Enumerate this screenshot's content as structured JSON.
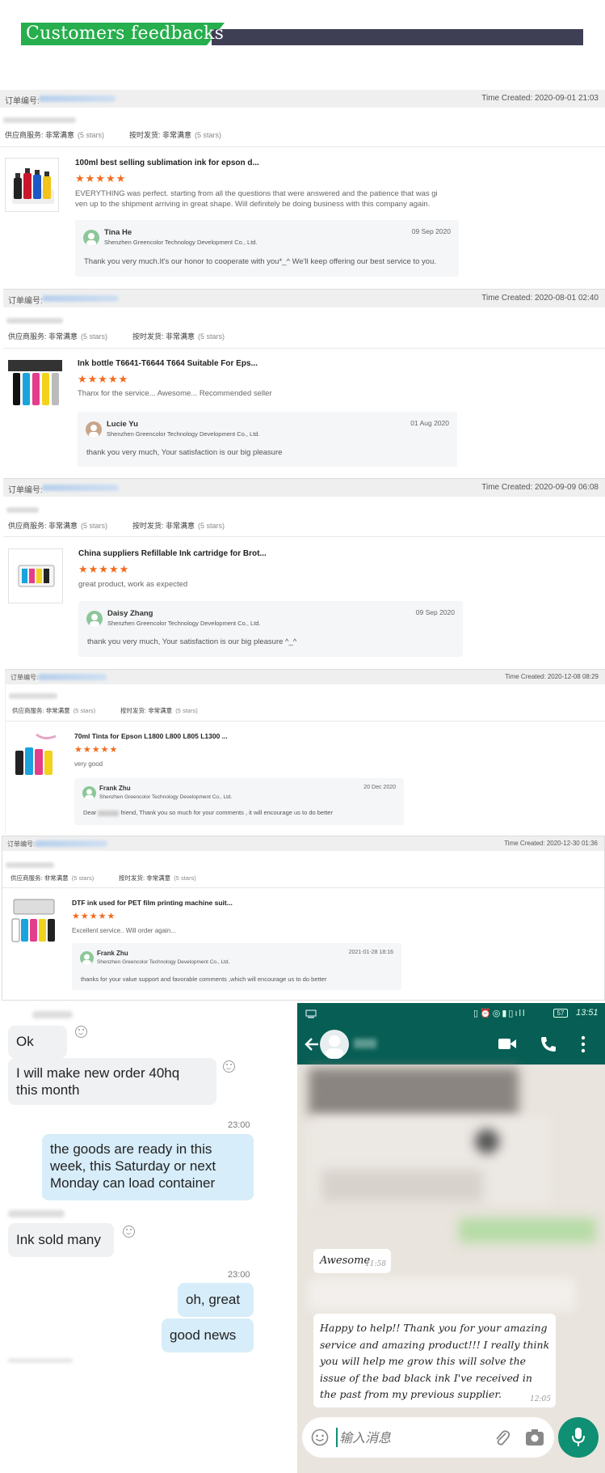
{
  "header": {
    "title": "Customers feedbacks",
    "accent": "#27ae4d",
    "bar_color": "#3e3f55"
  },
  "labels": {
    "order_no": "订单编号:",
    "time_prefix": "Time Created: ",
    "supplier_service": "供应商服务:",
    "ship_on_time": "按时发货:",
    "very_satisfied": "非常满意",
    "five_stars": "(5 stars)",
    "stars": "★★★★★",
    "company": "Shenzhen Greencolor Technology Development Co., Ltd."
  },
  "reviews": [
    {
      "time": "2020-09-01 21:03",
      "product": "100ml best selling sublimation ink for epson d...",
      "text_lines": [
        "EVERYTHING was perfect. starting from all the questions that were answered and the patience that was gi",
        "ven up to the shipment arriving in great shape. Will definitely be doing business with this company again."
      ],
      "reply_name": "Tina He",
      "reply_date": "09 Sep 2020",
      "reply_text": "Thank you very much.It's our honor to cooperate with you*_^  We'll keep offering our best service to you."
    },
    {
      "time": "2020-08-01 02:40",
      "product": "Ink bottle T6641-T6644 T664 Suitable For Eps...",
      "text_lines": [
        "Thanx for the service... Awesome... Recommended seller"
      ],
      "reply_name": "Lucie Yu",
      "reply_date": "01 Aug 2020",
      "reply_text": "thank you very much, Your satisfaction is our big pleasure"
    },
    {
      "time": "2020-09-09 06:08",
      "product": "China suppliers Refillable Ink cartridge for Brot...",
      "text_lines": [
        "great product, work as expected"
      ],
      "reply_name": "Daisy Zhang",
      "reply_date": "09 Sep 2020",
      "reply_text": "thank you very much, Your satisfaction is our big pleasure ^_^"
    },
    {
      "time": "2020-12-08 08:29",
      "product": "70ml Tinta for Epson L1800 L800 L805 L1300 ...",
      "text_lines": [
        "very good"
      ],
      "reply_name": "Frank Zhu",
      "reply_date": "20 Dec 2020",
      "reply_text_a": "Dear",
      "reply_text_b": "friend, Thank you so  much  for your comments , it will encourage us to do better"
    },
    {
      "time": "2020-12-30 01:36",
      "product": "DTF ink used for PET film printing machine suit...",
      "text_lines": [
        "Excellent service.. Will order again..."
      ],
      "reply_name": "Frank Zhu",
      "reply_date": "2021-01-28 18:16",
      "reply_text": "thanks for your value support  and favorable comments ,which will encourage us to do better"
    }
  ],
  "chat_left": {
    "msg1": "Ok",
    "msg2_l1": "I will make new order 40hq",
    "msg2_l2": "this month",
    "time1": "23:00",
    "msg3_l1": "the goods are ready in this",
    "msg3_l2": "week, this Saturday or next",
    "msg3_l3": "Monday can load container",
    "msg4": "Ink sold many",
    "time2": "23:00",
    "msg5": "oh, great",
    "msg6": "good news"
  },
  "whatsapp": {
    "clock": "13:51",
    "battery": "57",
    "awesome": "Awesome",
    "awesome_time": "11:58",
    "reply_lines": [
      "Happy to help!! Thank you for your amazing",
      "service and amazing product!!! I really think",
      "you will help me grow this will solve the",
      "issue of the bad black ink I've received in",
      "the past from my previous supplier."
    ],
    "reply_time": "12:05",
    "input_placeholder": "输入消息",
    "brand": "#075e54"
  }
}
